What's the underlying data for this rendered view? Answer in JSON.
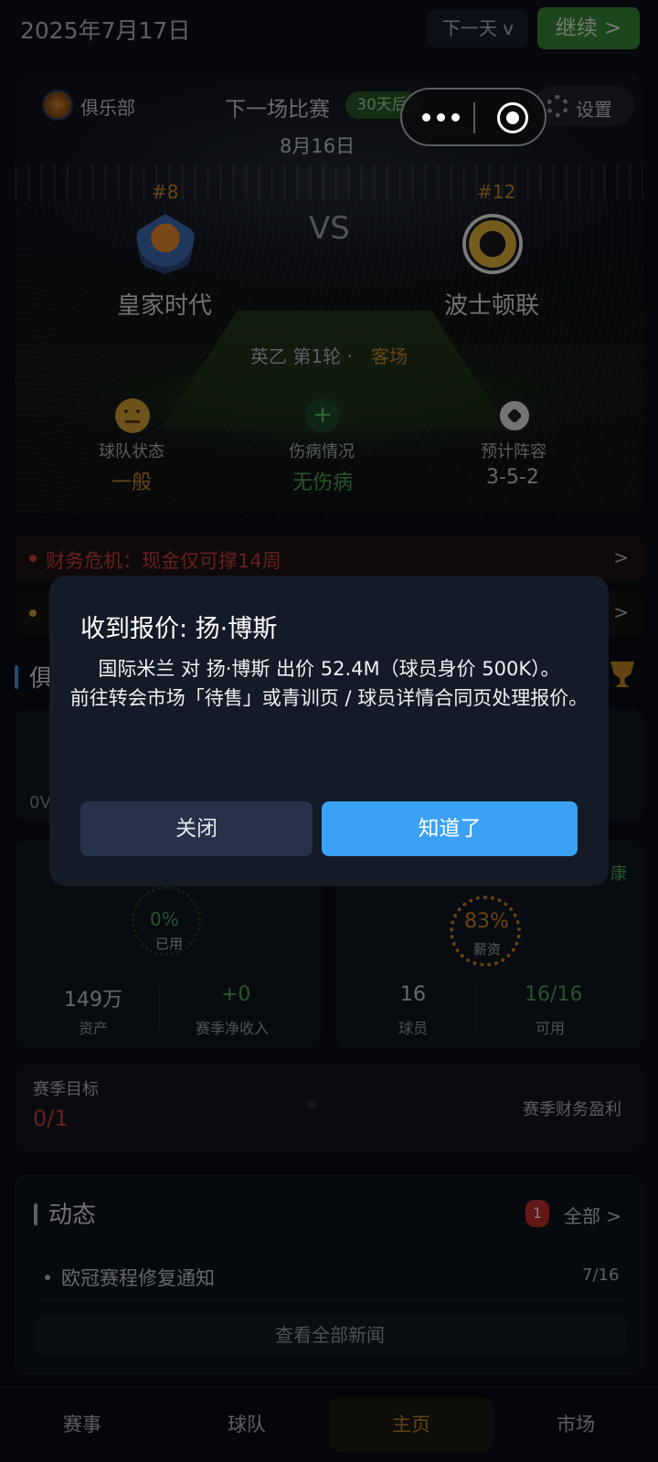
{
  "topbar": {
    "date": "2025年7月17日",
    "next_day": "下一天 v",
    "continue": "继续 >"
  },
  "match": {
    "club_label": "俱乐部",
    "next_match_label": "下一场比赛",
    "days_badge": "30天后",
    "date": "8月16日",
    "settings_label": "设置",
    "home": {
      "rank": "#8",
      "name": "皇家时代"
    },
    "away": {
      "rank": "#12",
      "name": "波士顿联"
    },
    "vs": "VS",
    "league": "英乙 第1轮  ·",
    "venue": "客场",
    "stats": [
      {
        "label": "球队状态",
        "value": "一般",
        "icon": "neutral-face-icon",
        "color": "#d08a28"
      },
      {
        "label": "伤病情况",
        "value": "无伤病",
        "icon": "plus-icon",
        "color": "#4fa85a"
      },
      {
        "label": "预计阵容",
        "value": "3-5-2",
        "icon": "soccer-ball-icon",
        "color": "#c9ced6"
      }
    ]
  },
  "alerts": [
    {
      "text": "财务危机：现金仅可撑14周",
      "color": "#c9433f"
    },
    {
      "text": "",
      "color": "#c9a23f"
    }
  ],
  "club_section": {
    "title": "俱",
    "left_partial": "0V",
    "finance_card": {
      "ring_value": "0%",
      "ring_label": "已用",
      "metrics": [
        {
          "value": "149万",
          "label": "资产",
          "color": "#c9ced6"
        },
        {
          "value": "+0",
          "label": "赛季净收入",
          "color": "#4fa85a"
        }
      ]
    },
    "squad_card": {
      "status_partial": "康",
      "ring_value": "83%",
      "ring_label": "薪资",
      "metrics": [
        {
          "value": "16",
          "label": "球员",
          "color": "#c9ced6"
        },
        {
          "value": "16/16",
          "label": "可用",
          "color": "#4fa85a"
        }
      ]
    }
  },
  "season_goal": {
    "label": "赛季目标",
    "value": "0/1",
    "target": "赛季财务盈利"
  },
  "news": {
    "title": "动态",
    "badge": "1",
    "all_link": "全部 >",
    "items": [
      {
        "title": "欧冠赛程修复通知",
        "date": "7/16"
      }
    ],
    "view_all": "查看全部新闻"
  },
  "tabs": [
    {
      "label": "赛事",
      "active": false
    },
    {
      "label": "球队",
      "active": false
    },
    {
      "label": "主页",
      "active": true
    },
    {
      "label": "市场",
      "active": false
    }
  ],
  "modal": {
    "title": "收到报价: 扬·博斯",
    "body_line1": "国际米兰 对 扬·博斯 出价 52.4M（球员身价 500K）。",
    "body_line2": "前往转会市场「待售」或青训页 / 球员详情合同页处理报价。",
    "close": "关闭",
    "ok": "知道了"
  }
}
